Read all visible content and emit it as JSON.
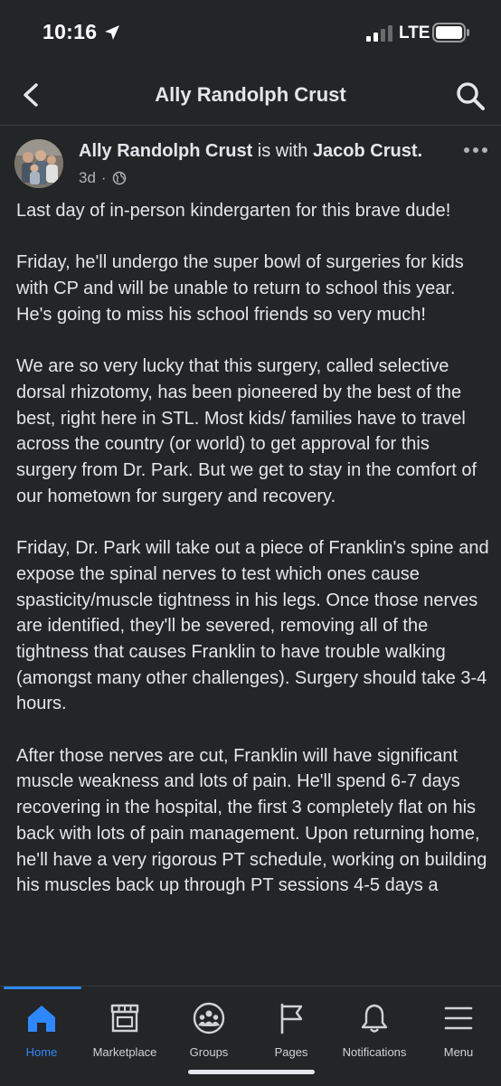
{
  "status_bar": {
    "time": "10:16",
    "network": "LTE"
  },
  "header": {
    "title": "Ally Randolph Crust",
    "back_icon": "chevron-left-icon",
    "search_icon": "search-icon"
  },
  "post": {
    "author": "Ally Randolph Crust",
    "with_text": "is with",
    "tagged": "Jacob Crust.",
    "time": "3d",
    "separator": "·",
    "privacy_icon": "globe-icon",
    "paragraphs": [
      "Last day of in-person kindergarten for this brave dude!",
      "Friday, he'll undergo the super bowl of surgeries for kids with CP and will be unable to return to school this year.  He's going to miss his school friends so very much!",
      "We are so very lucky that this surgery, called selective dorsal rhizotomy, has been pioneered by the best of the best, right here in STL.  Most kids/ families have to travel across the country (or world) to get approval for this surgery from Dr. Park.  But we get to stay in the comfort of our hometown for surgery and recovery.",
      "Friday, Dr. Park will take out a piece of Franklin's spine and expose the spinal nerves to test which ones cause spasticity/muscle tightness in his legs. Once those nerves are identified, they'll be severed, removing all of the tightness that causes Franklin to have trouble walking (amongst many other challenges).  Surgery should take 3-4 hours.",
      "After those nerves are cut, Franklin will have significant muscle weakness and lots of pain.  He'll spend 6-7 days recovering in the hospital, the first 3 completely flat on his back with lots of pain management.  Upon returning home, he'll have a very rigorous PT schedule, working on building his muscles back up through PT sessions 4-5 days a"
    ]
  },
  "tab_bar": {
    "items": [
      {
        "label": "Home",
        "icon": "home-icon",
        "active": true
      },
      {
        "label": "Marketplace",
        "icon": "marketplace-icon",
        "active": false
      },
      {
        "label": "Groups",
        "icon": "groups-icon",
        "active": false
      },
      {
        "label": "Pages",
        "icon": "pages-flag-icon",
        "active": false
      },
      {
        "label": "Notifications",
        "icon": "bell-icon",
        "active": false
      },
      {
        "label": "Menu",
        "icon": "menu-icon",
        "active": false
      }
    ]
  },
  "colors": {
    "background": "#242526",
    "text": "#e4e6eb",
    "secondary_text": "#b0b3b8",
    "accent": "#2d88ff"
  }
}
